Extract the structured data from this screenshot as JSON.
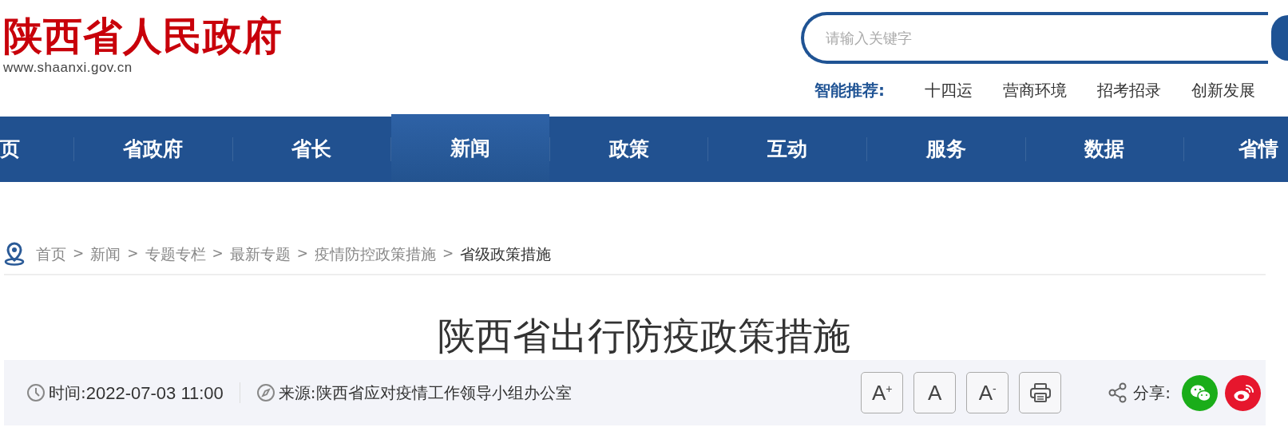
{
  "logo": {
    "title": "陕西省人民政府",
    "url": "www.shaanxi.gov.cn"
  },
  "search": {
    "placeholder": "请输入关键字"
  },
  "recommend": {
    "label": "智能推荐:",
    "items": [
      "十四运",
      "营商环境",
      "招考招录",
      "创新发展"
    ]
  },
  "nav": [
    {
      "label": "页",
      "selected": false
    },
    {
      "label": "省政府",
      "selected": false
    },
    {
      "label": "省长",
      "selected": false
    },
    {
      "label": "新闻",
      "selected": true
    },
    {
      "label": "政策",
      "selected": false
    },
    {
      "label": "互动",
      "selected": false
    },
    {
      "label": "服务",
      "selected": false
    },
    {
      "label": "数据",
      "selected": false
    },
    {
      "label": "省情",
      "selected": false
    }
  ],
  "breadcrumb": [
    "首页",
    "新闻",
    "专题专栏",
    "最新专题",
    "疫情防控政策措施",
    "省级政策措施"
  ],
  "breadcrumb_separator": ">",
  "article": {
    "title": "陕西省出行防疫政策措施",
    "time_label": "时间:",
    "time": "2022-07-03 11:00",
    "source_label": "来源:",
    "source": "陕西省应对疫情工作领导小组办公室",
    "font_buttons": [
      {
        "kind": "larger",
        "label": "A",
        "mark": "+"
      },
      {
        "kind": "normal",
        "label": "A"
      },
      {
        "kind": "smaller",
        "label": "A",
        "mark": "-"
      },
      {
        "kind": "print"
      }
    ],
    "share_label": "分享:",
    "share": [
      {
        "kind": "wechat",
        "color": "#1aad19"
      },
      {
        "kind": "weibo",
        "color": "#e6162d"
      }
    ]
  }
}
